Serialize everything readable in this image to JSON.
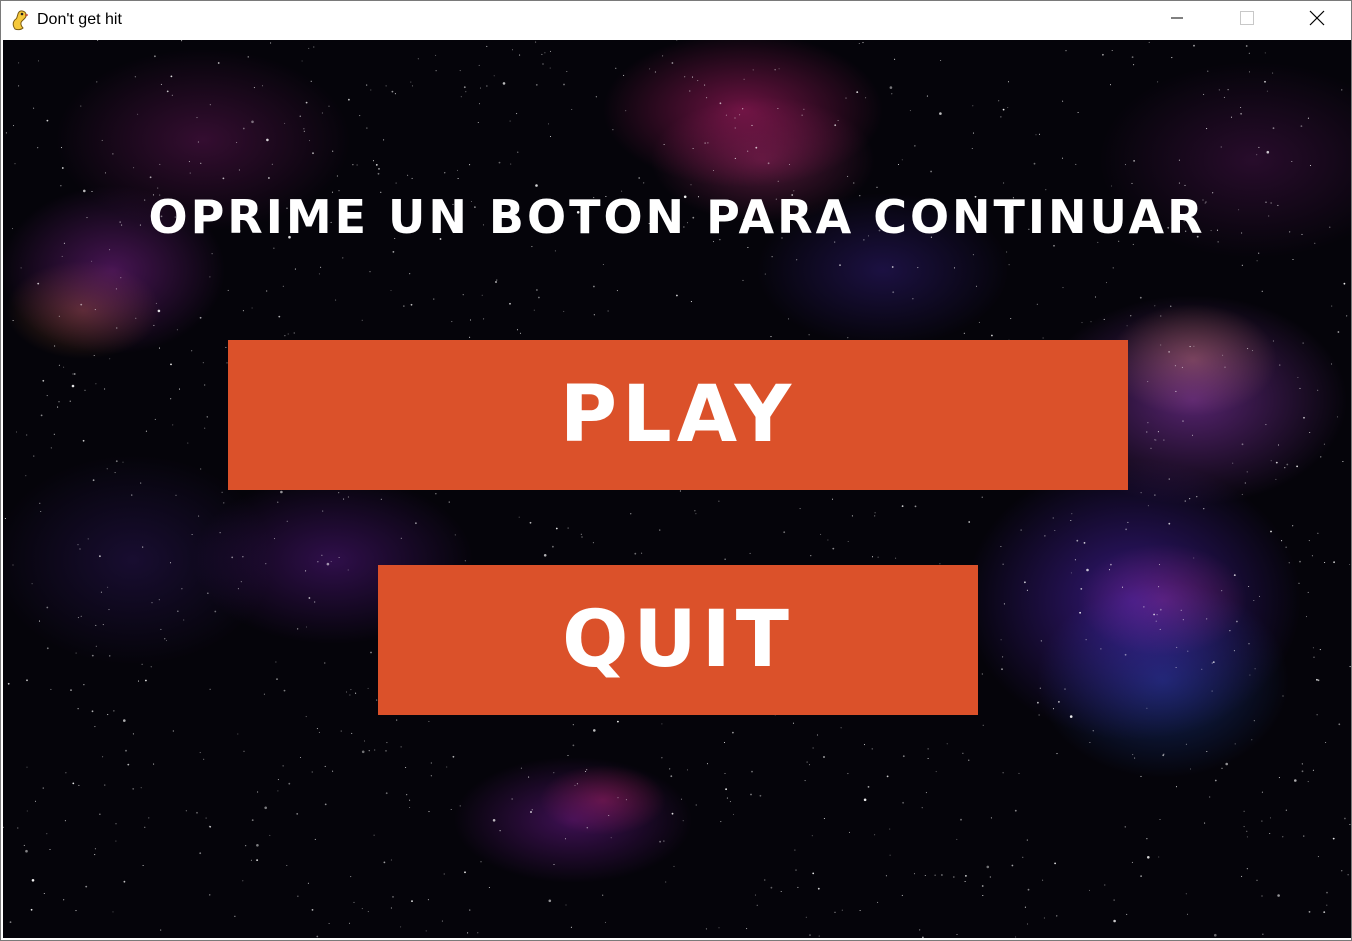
{
  "window": {
    "title": "Don't get hit",
    "icon": "pygame-snake-icon",
    "controls": [
      "minimize-icon",
      "maximize-icon",
      "close-icon"
    ]
  },
  "game": {
    "headline": "OPRIME UN BOTON PARA CONTINUAR",
    "play_label": "PLAY",
    "quit_label": "QUIT",
    "button_color": "#db512a",
    "text_color": "#ffffff",
    "background": "starfield-nebula"
  }
}
